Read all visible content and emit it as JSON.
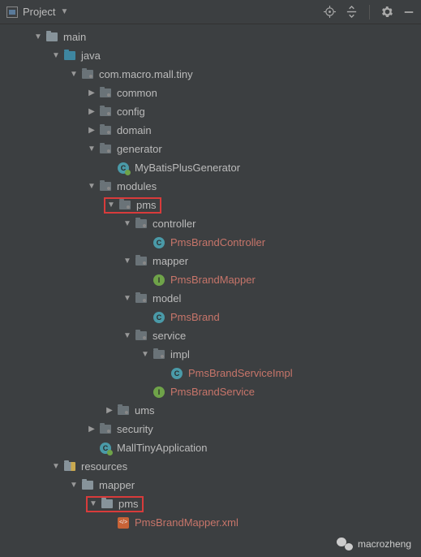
{
  "toolbar": {
    "title": "Project"
  },
  "tree": [
    {
      "indent": 0,
      "arrow": "down",
      "icon": "folder",
      "label": "main",
      "red": false
    },
    {
      "indent": 1,
      "arrow": "down",
      "icon": "folder-src",
      "label": "java",
      "red": false
    },
    {
      "indent": 2,
      "arrow": "down",
      "icon": "folder-pkg",
      "label": "com.macro.mall.tiny",
      "red": false
    },
    {
      "indent": 3,
      "arrow": "right",
      "icon": "folder-pkg",
      "label": "common",
      "red": false
    },
    {
      "indent": 3,
      "arrow": "right",
      "icon": "folder-pkg",
      "label": "config",
      "red": false
    },
    {
      "indent": 3,
      "arrow": "right",
      "icon": "folder-pkg",
      "label": "domain",
      "red": false
    },
    {
      "indent": 3,
      "arrow": "down",
      "icon": "folder-pkg",
      "label": "generator",
      "red": false
    },
    {
      "indent": 4,
      "arrow": "none",
      "icon": "class-c-green",
      "label": "MyBatisPlusGenerator",
      "red": false,
      "letter": "C"
    },
    {
      "indent": 3,
      "arrow": "down",
      "icon": "folder-pkg",
      "label": "modules",
      "red": false
    },
    {
      "indent": 4,
      "arrow": "down",
      "icon": "folder-pkg",
      "label": "pms",
      "red": false,
      "highlight": true
    },
    {
      "indent": 5,
      "arrow": "down",
      "icon": "folder-pkg",
      "label": "controller",
      "red": false
    },
    {
      "indent": 6,
      "arrow": "none",
      "icon": "class-c",
      "label": "PmsBrandController",
      "red": true,
      "letter": "C"
    },
    {
      "indent": 5,
      "arrow": "down",
      "icon": "folder-pkg",
      "label": "mapper",
      "red": false
    },
    {
      "indent": 6,
      "arrow": "none",
      "icon": "class-i",
      "label": "PmsBrandMapper",
      "red": true,
      "letter": "I"
    },
    {
      "indent": 5,
      "arrow": "down",
      "icon": "folder-pkg",
      "label": "model",
      "red": false
    },
    {
      "indent": 6,
      "arrow": "none",
      "icon": "class-c",
      "label": "PmsBrand",
      "red": true,
      "letter": "C"
    },
    {
      "indent": 5,
      "arrow": "down",
      "icon": "folder-pkg",
      "label": "service",
      "red": false
    },
    {
      "indent": 6,
      "arrow": "down",
      "icon": "folder-pkg",
      "label": "impl",
      "red": false
    },
    {
      "indent": 7,
      "arrow": "none",
      "icon": "class-c",
      "label": "PmsBrandServiceImpl",
      "red": true,
      "letter": "C"
    },
    {
      "indent": 6,
      "arrow": "none",
      "icon": "class-i",
      "label": "PmsBrandService",
      "red": true,
      "letter": "I"
    },
    {
      "indent": 4,
      "arrow": "right",
      "icon": "folder-pkg",
      "label": "ums",
      "red": false
    },
    {
      "indent": 3,
      "arrow": "right",
      "icon": "folder-pkg",
      "label": "security",
      "red": false
    },
    {
      "indent": 3,
      "arrow": "none",
      "icon": "class-c-green",
      "label": "MallTinyApplication",
      "red": false,
      "letter": "C"
    },
    {
      "indent": 1,
      "arrow": "down",
      "icon": "folder-res",
      "label": "resources",
      "red": false
    },
    {
      "indent": 2,
      "arrow": "down",
      "icon": "folder",
      "label": "mapper",
      "red": false
    },
    {
      "indent": 3,
      "arrow": "down",
      "icon": "folder",
      "label": "pms",
      "red": false,
      "highlight": true
    },
    {
      "indent": 4,
      "arrow": "none",
      "icon": "xml",
      "label": "PmsBrandMapper.xml",
      "red": true
    }
  ],
  "watermark": "macrozheng"
}
